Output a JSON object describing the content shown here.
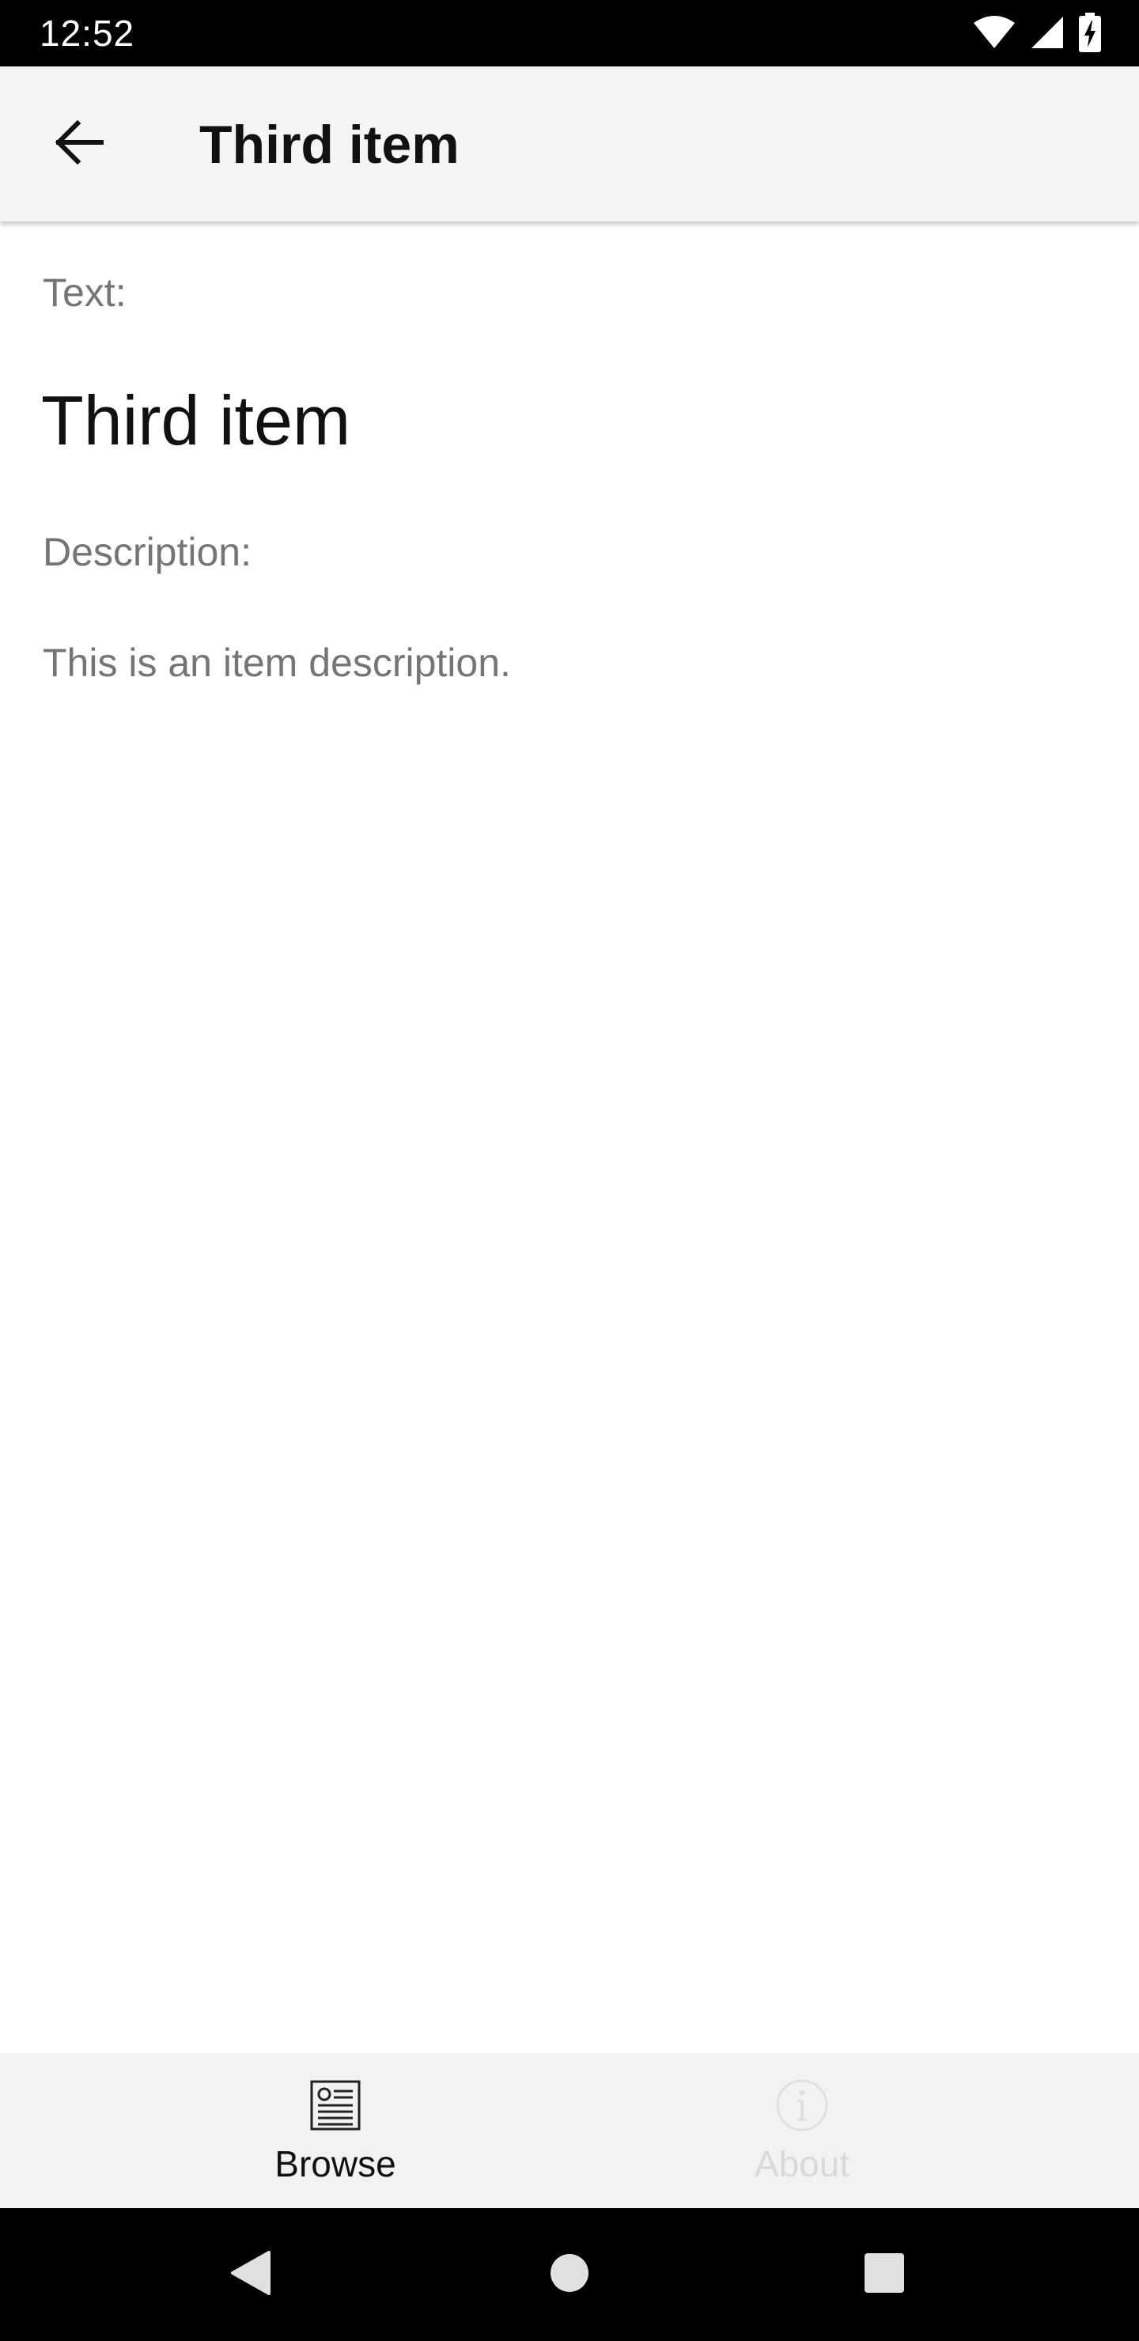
{
  "status_bar": {
    "time": "12:52",
    "icons": [
      "wifi-icon",
      "signal-icon",
      "battery-charging-icon"
    ]
  },
  "app_bar": {
    "back_icon": "arrow-left-icon",
    "title": "Third item"
  },
  "detail": {
    "text_label": "Text:",
    "text_value": "Third item",
    "description_label": "Description:",
    "description_value": "This is an item description."
  },
  "tabs": [
    {
      "label": "Browse",
      "icon": "browse-icon",
      "active": true
    },
    {
      "label": "About",
      "icon": "info-icon",
      "active": false
    }
  ],
  "nav_bar": {
    "buttons": [
      "back-triangle-icon",
      "home-circle-icon",
      "recents-square-icon"
    ]
  },
  "colors": {
    "app_bar_bg": "#f5f5f5",
    "tab_bar_bg": "#f2f2f2",
    "label_gray": "#757575",
    "inactive_tab": "#d9d9d9",
    "text_dark": "#111111"
  }
}
